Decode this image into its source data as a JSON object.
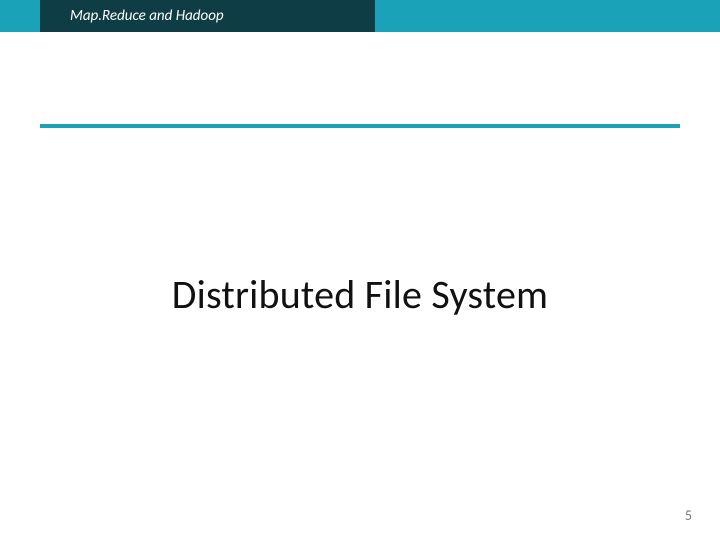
{
  "header": {
    "topic_label": "Map.Reduce and Hadoop"
  },
  "main": {
    "title": "Distributed File System"
  },
  "footer": {
    "page_number": "5"
  },
  "colors": {
    "accent_teal": "#1aa3b8",
    "header_dark": "#0f3d45"
  }
}
